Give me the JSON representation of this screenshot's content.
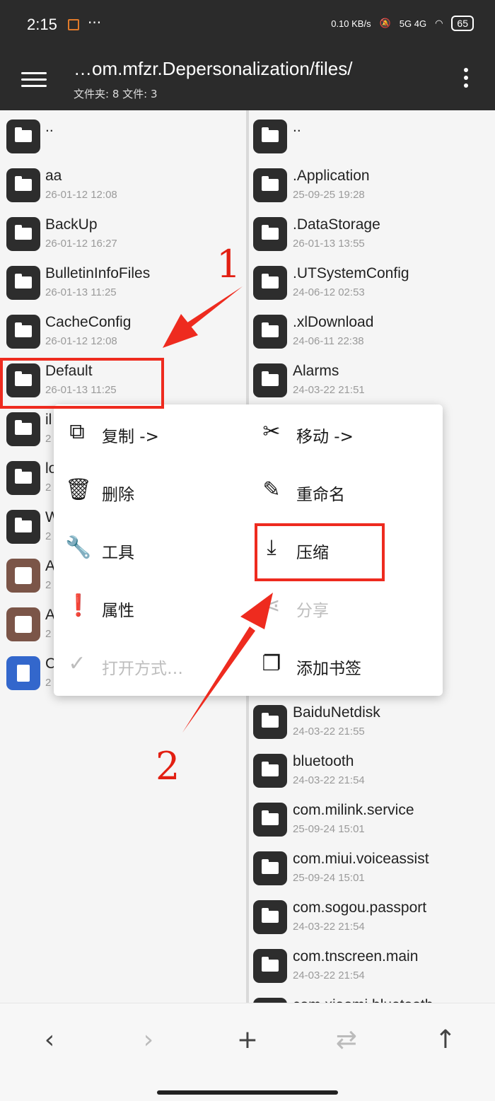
{
  "status": {
    "time": "2:15",
    "more": "···",
    "speed": "0.10 KB/s",
    "signals": "5G 4G",
    "battery": "65"
  },
  "appbar": {
    "path": "…om.mfzr.Depersonalization/files/",
    "counts": "文件夹: 8  文件: 3"
  },
  "left_pane": [
    {
      "name": "..",
      "date": "",
      "icon": "folder-icon"
    },
    {
      "name": "aa",
      "date": "26-01-12 12:08",
      "icon": "folder-icon"
    },
    {
      "name": "BackUp",
      "date": "26-01-12 16:27",
      "icon": "folder-icon"
    },
    {
      "name": "BulletinInfoFiles",
      "date": "26-01-13 11:25",
      "icon": "folder-icon"
    },
    {
      "name": "CacheConfig",
      "date": "26-01-12 12:08",
      "icon": "folder-icon"
    },
    {
      "name": "Default",
      "date": "26-01-13 11:25",
      "icon": "folder-icon"
    },
    {
      "name": "il",
      "date": "2",
      "icon": "folder-icon"
    },
    {
      "name": "lo",
      "date": "2",
      "icon": "folder-icon"
    },
    {
      "name": "W",
      "date": "2",
      "icon": "folder-icon"
    },
    {
      "name": "A",
      "date": "2",
      "icon": "archive-icon"
    },
    {
      "name": "A",
      "date": "2",
      "icon": "archive-icon"
    },
    {
      "name": "C",
      "date": "2",
      "icon": "document-icon"
    }
  ],
  "right_pane": [
    {
      "name": "..",
      "date": ""
    },
    {
      "name": ".Application",
      "date": "25-09-25 19:28"
    },
    {
      "name": ".DataStorage",
      "date": "26-01-13 13:55"
    },
    {
      "name": ".UTSystemConfig",
      "date": "24-06-12 02:53"
    },
    {
      "name": ".xlDownload",
      "date": "24-06-11 22:38"
    },
    {
      "name": "Alarms",
      "date": "24-03-22 21:51"
    },
    {
      "name": "BaiduNetdisk",
      "date": "24-03-22 21:55"
    },
    {
      "name": "bluetooth",
      "date": "24-03-22 21:54"
    },
    {
      "name": "com.milink.service",
      "date": "25-09-24 15:01"
    },
    {
      "name": "com.miui.voiceassist",
      "date": "25-09-24 15:01"
    },
    {
      "name": "com.sogou.passport",
      "date": "24-03-22 21:54"
    },
    {
      "name": "com.tnscreen.main",
      "date": "24-03-22 21:54"
    },
    {
      "name": "com.xiaomi.bluetooth",
      "date": ""
    }
  ],
  "menu": {
    "copy": "复制 ->",
    "move": "移动 ->",
    "delete": "删除",
    "rename": "重命名",
    "tools": "工具",
    "compress": "压缩",
    "properties": "属性",
    "share": "分享",
    "open_with": "打开方式…",
    "bookmark": "添加书签"
  },
  "annotations": {
    "step1": "1",
    "step2": "2",
    "color": "#ee2b1f"
  },
  "bottom": {
    "back": "‹",
    "forward": "›",
    "add": "+",
    "swap": "⇄",
    "up": "↑"
  }
}
